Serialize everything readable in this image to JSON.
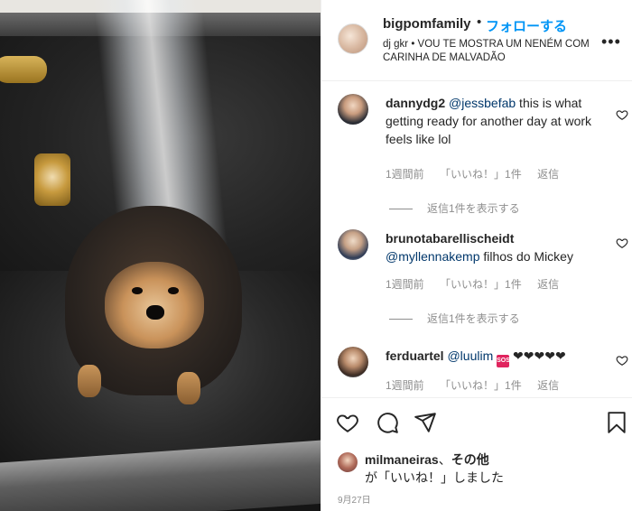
{
  "post": {
    "owner": "bigpomfamily",
    "separator": "•",
    "follow_label": "フォローする",
    "caption": "dj gkr • VOU TE MOSTRA UM NENÉM COM CARINHA DE MALVADÃO",
    "more_icon": "more-dots-icon"
  },
  "comments": [
    {
      "user": "dannydg2",
      "mention": "@jessbefab",
      "text": " this is what getting ready for another day at work feels like lol",
      "time": "1週間前",
      "likes": "「いいね！」1件",
      "reply": "返信",
      "view_replies": "返信1件を表示する"
    },
    {
      "user": "brunotabarellischeidt",
      "mention": "@myllennakemp",
      "text": " filhos do Mickey",
      "time": "1週間前",
      "likes": "「いいね！」1件",
      "reply": "返信",
      "view_replies": "返信1件を表示する"
    },
    {
      "user": "ferduartel",
      "mention": "@luulim",
      "emoji_badge": "SOS",
      "text": " ❤❤❤❤❤",
      "time": "1週間前",
      "likes": "「いいね！」1件",
      "reply": "返信"
    }
  ],
  "footer": {
    "liker": "milmaneiras",
    "liked_suffix": "、",
    "others": "その他",
    "liked_text": "が「いいね！」しました",
    "date": "9月27日"
  },
  "colors": {
    "accent": "#0095f6",
    "mention": "#00376b",
    "muted": "#8e8e8e",
    "text": "#262626"
  }
}
